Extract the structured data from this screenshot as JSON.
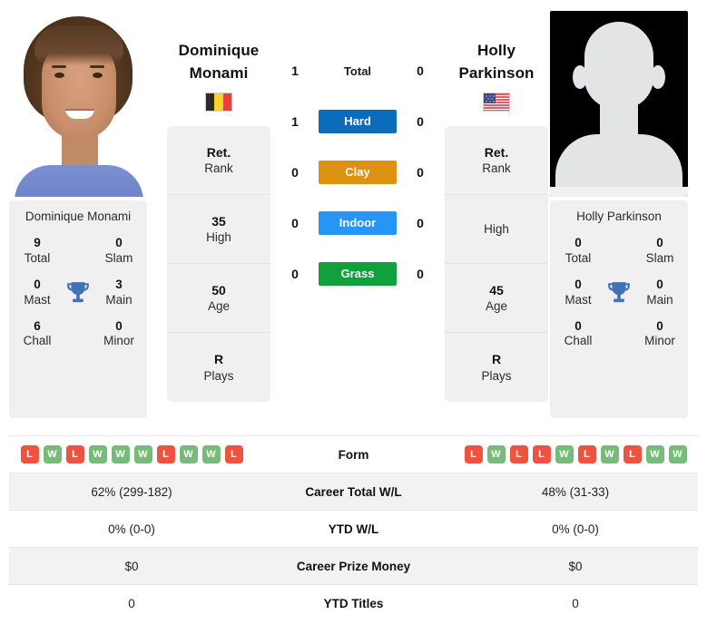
{
  "players": {
    "left": {
      "first_name": "Dominique",
      "last_name": "Monami",
      "full_name": "Dominique Monami",
      "country": "Belgium",
      "flag_icon": "flag-belgium",
      "photo_alt": "Dominique Monami portrait",
      "titles": {
        "total_value": "9",
        "total_label": "Total",
        "slam_value": "0",
        "slam_label": "Slam",
        "mast_value": "0",
        "mast_label": "Mast",
        "main_value": "3",
        "main_label": "Main",
        "chall_value": "6",
        "chall_label": "Chall",
        "minor_value": "0",
        "minor_label": "Minor",
        "trophy_icon": "trophy-icon"
      },
      "stats": [
        {
          "value": "Ret.",
          "label": "Rank"
        },
        {
          "value": "35",
          "label": "High"
        },
        {
          "value": "50",
          "label": "Age"
        },
        {
          "value": "R",
          "label": "Plays"
        }
      ],
      "form": [
        "L",
        "W",
        "L",
        "W",
        "W",
        "W",
        "L",
        "W",
        "W",
        "L"
      ],
      "career_total_wl": "62% (299-182)",
      "ytd_wl": "0% (0-0)",
      "career_prize_money": "$0",
      "ytd_titles": "0"
    },
    "right": {
      "first_name": "Holly",
      "last_name": "Parkinson",
      "full_name": "Holly Parkinson",
      "country": "United States",
      "flag_icon": "flag-usa",
      "photo_alt": "player silhouette placeholder",
      "titles": {
        "total_value": "0",
        "total_label": "Total",
        "slam_value": "0",
        "slam_label": "Slam",
        "mast_value": "0",
        "mast_label": "Mast",
        "main_value": "0",
        "main_label": "Main",
        "chall_value": "0",
        "chall_label": "Chall",
        "minor_value": "0",
        "minor_label": "Minor",
        "trophy_icon": "trophy-icon"
      },
      "stats": [
        {
          "value": "Ret.",
          "label": "Rank"
        },
        {
          "value": "",
          "label": "High"
        },
        {
          "value": "45",
          "label": "Age"
        },
        {
          "value": "R",
          "label": "Plays"
        }
      ],
      "form": [
        "L",
        "W",
        "L",
        "L",
        "W",
        "L",
        "W",
        "L",
        "W",
        "W"
      ],
      "career_total_wl": "48% (31-33)",
      "ytd_wl": "0% (0-0)",
      "career_prize_money": "$0",
      "ytd_titles": "0"
    }
  },
  "head_to_head": {
    "rows": [
      {
        "label": "Total",
        "left": "1",
        "right": "0",
        "style": "plain",
        "color": ""
      },
      {
        "label": "Hard",
        "left": "1",
        "right": "0",
        "style": "badge",
        "color": "#0c6cba"
      },
      {
        "label": "Clay",
        "left": "0",
        "right": "0",
        "style": "badge",
        "color": "#dd9110"
      },
      {
        "label": "Indoor",
        "left": "0",
        "right": "0",
        "style": "badge",
        "color": "#2596f5"
      },
      {
        "label": "Grass",
        "left": "0",
        "right": "0",
        "style": "badge",
        "color": "#0ea13c"
      }
    ]
  },
  "comparison_table": {
    "rows": [
      {
        "label": "Form",
        "type": "form"
      },
      {
        "label": "Career Total W/L",
        "type": "text",
        "left": "62% (299-182)",
        "right": "48% (31-33)"
      },
      {
        "label": "YTD W/L",
        "type": "text",
        "left": "0% (0-0)",
        "right": "0% (0-0)"
      },
      {
        "label": "Career Prize Money",
        "type": "text",
        "left": "$0",
        "right": "$0"
      },
      {
        "label": "YTD Titles",
        "type": "text",
        "left": "0",
        "right": "0"
      }
    ]
  },
  "colors": {
    "hard": "#0c6cba",
    "clay": "#dd9110",
    "indoor": "#2596f5",
    "grass": "#0ea13c",
    "win_badge": "#76bb7a",
    "loss_badge": "#ee5340",
    "card_bg": "#f0f0f0",
    "row_shade": "#f2f2f2"
  }
}
